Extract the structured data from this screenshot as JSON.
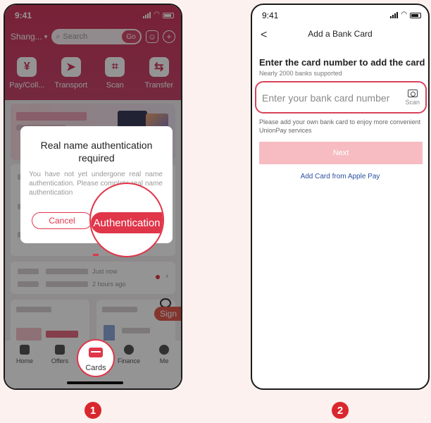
{
  "screen1": {
    "status": {
      "time": "9:41"
    },
    "header": {
      "city": "Shang...",
      "search_placeholder": "Search",
      "go_label": "Go"
    },
    "quick_actions": [
      {
        "label": "Pay/Coll...",
        "icon": "yen-icon",
        "glyph": "¥"
      },
      {
        "label": "Transport",
        "icon": "transport-icon",
        "glyph": "➤"
      },
      {
        "label": "Scan",
        "icon": "scan-icon",
        "glyph": "⌗"
      },
      {
        "label": "Transfer",
        "icon": "transfer-icon",
        "glyph": "⇆"
      }
    ],
    "feed": {
      "just_now": "Just now",
      "two_hours": "2 hours ago",
      "sign_label": "Sign"
    },
    "dialog": {
      "title": "Real name authentication required",
      "body": "You have not yet undergone real name authentication. Please complete real name authentication",
      "cancel_label": "Cancel",
      "auth_label": "Authentication"
    },
    "tabs": [
      {
        "label": "Home"
      },
      {
        "label": "Offers"
      },
      {
        "label": "Cards"
      },
      {
        "label": "Finance"
      },
      {
        "label": "Me"
      }
    ]
  },
  "screen2": {
    "status": {
      "time": "9:41"
    },
    "nav": {
      "title": "Add a Bank Card",
      "back_glyph": "<"
    },
    "heading": "Enter the card number to add the card",
    "subheading": "Nearly 2000 banks supported",
    "input": {
      "placeholder": "Enter your bank card number",
      "value": ""
    },
    "scan_label": "Scan",
    "hint": "Please add your own bank card to enjoy more convenient UnionPay services",
    "next_label": "Next",
    "apple_pay_label": "Add Card from Apple Pay"
  },
  "steps": [
    "1",
    "2"
  ],
  "colors": {
    "accent": "#e0364a",
    "header": "#d03a60",
    "next_disabled": "#f6bcc2",
    "link": "#2c4fa3"
  }
}
